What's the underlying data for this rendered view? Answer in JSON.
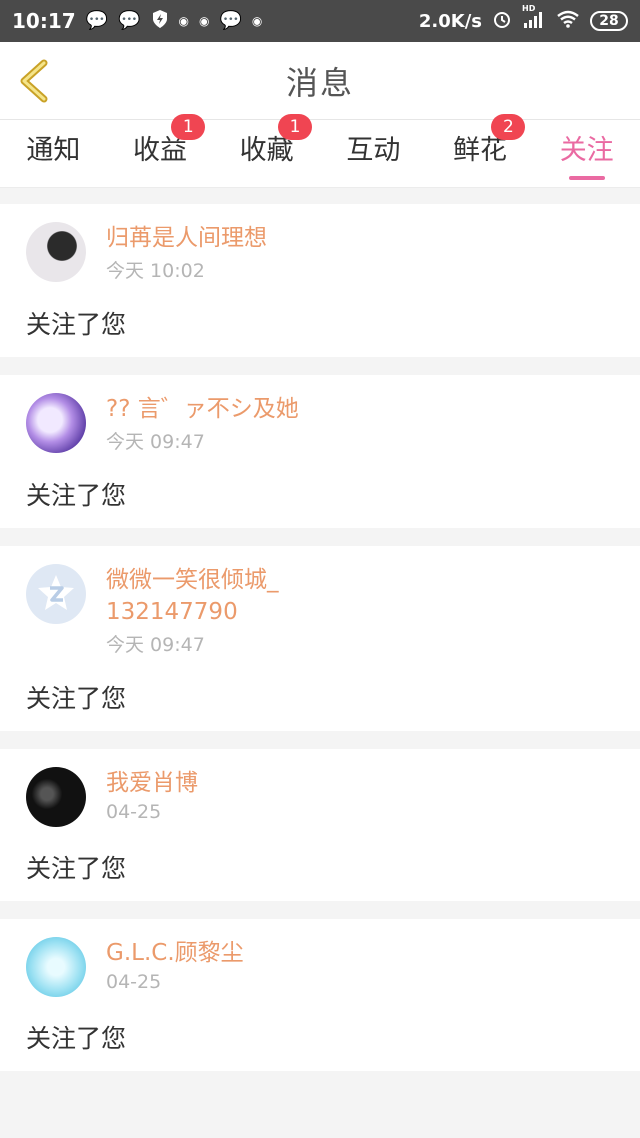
{
  "status_bar": {
    "time": "10:17",
    "net_speed": "2.0K/s",
    "signal_label": "HD",
    "battery": "28",
    "icons": [
      "wechat-icon",
      "wechat-icon",
      "shield-icon",
      "app-icon",
      "app-icon",
      "wechat-icon",
      "app-icon",
      "alarm-icon",
      "signal-icon",
      "wifi-icon",
      "battery-icon"
    ]
  },
  "header": {
    "title": "消息",
    "back_icon": "chevron-left-icon"
  },
  "tabs": [
    {
      "label": "通知",
      "badge": null,
      "active": false
    },
    {
      "label": "收益",
      "badge": "1",
      "active": false
    },
    {
      "label": "收藏",
      "badge": "1",
      "active": false
    },
    {
      "label": "互动",
      "badge": null,
      "active": false
    },
    {
      "label": "鲜花",
      "badge": "2",
      "active": false
    },
    {
      "label": "关注",
      "badge": null,
      "active": true
    }
  ],
  "colors": {
    "accent": "#ea6aa2",
    "username": "#eb9a6b",
    "badge": "#f04552",
    "time": "#b5b5b5"
  },
  "follows": [
    {
      "username": "归苒是人间理想",
      "time": "今天 10:02",
      "action": "关注了您"
    },
    {
      "username": "?? 言゛ァ不シ及她",
      "time": "今天 09:47",
      "action": "关注了您"
    },
    {
      "username": "微微一笑很倾城_132147790",
      "time": "今天 09:47",
      "action": "关注了您"
    },
    {
      "username": "我爱肖博",
      "time": "04-25",
      "action": "关注了您"
    },
    {
      "username": "G.L.C.顾黎尘",
      "time": "04-25",
      "action": "关注了您"
    }
  ]
}
